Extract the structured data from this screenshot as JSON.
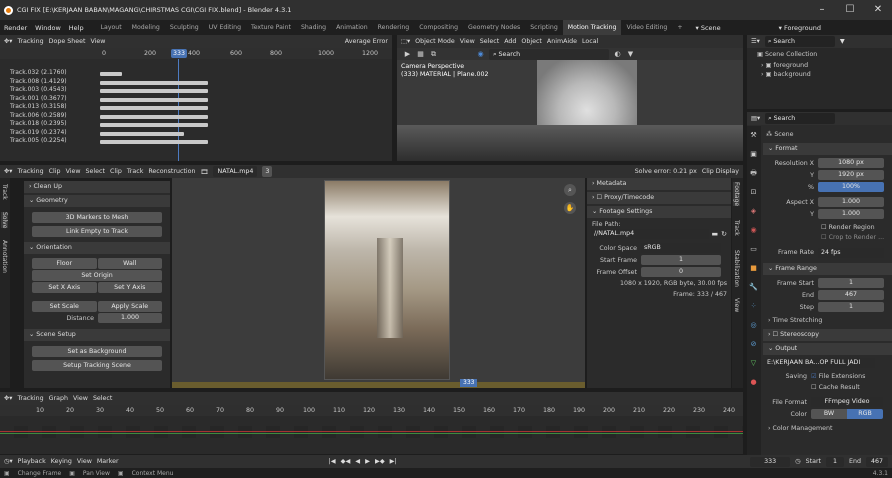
{
  "title": "CGI FIX [E:\\KERJAAN BABAN\\MAGANG\\CHIRSTMAS CGI\\CGI FIX.blend] - Blender 4.3.1",
  "menus": [
    "Render",
    "Window",
    "Help"
  ],
  "workspaces": [
    "Layout",
    "Modeling",
    "Sculpting",
    "UV Editing",
    "Texture Paint",
    "Shading",
    "Animation",
    "Rendering",
    "Compositing",
    "Geometry Nodes",
    "Scripting",
    "Motion Tracking",
    "Video Editing"
  ],
  "active_workspace": "Motion Tracking",
  "scene_label": "Scene",
  "view_layer": "Foreground",
  "dopesheet": {
    "mode": "Tracking",
    "sheet": "Dope Sheet",
    "view": "View",
    "sort": "Average Error",
    "ticks": [
      "0",
      "200",
      "400",
      "600",
      "800",
      "1000",
      "1200"
    ],
    "frame": "333",
    "tracks": [
      "Track.032 (2.1760)",
      "Track.008 (1.4129)",
      "Track.003 (0.4543)",
      "Track.001 (0.3677)",
      "Track.013 (0.3158)",
      "Track.006 (0.2589)",
      "Track.018 (0.2395)",
      "Track.019 (0.2374)",
      "Track.005 (0.2254)"
    ]
  },
  "viewport": {
    "mode": "Object Mode",
    "view": "View",
    "select": "Select",
    "add": "Add",
    "object": "Object",
    "animaide": "AnimAide",
    "orientation": "Local",
    "search": "Search",
    "overlay1": "Camera Perspective",
    "overlay2": "(333) MATERIAL | Plane.002"
  },
  "outliner": {
    "search": "Search",
    "root": "Scene Collection",
    "items": [
      "foreground",
      "background"
    ]
  },
  "clip": {
    "mode": "Tracking",
    "clip_menu": "Clip",
    "view": "View",
    "select": "Select",
    "clip": "Clip",
    "track": "Track",
    "reconstruction": "Reconstruction",
    "file": "NATAL.mp4",
    "users": "3",
    "solve": "Solve error: 0.21 px",
    "display": "Clip Display",
    "frame_badge": "333"
  },
  "tool_tabs": [
    "Track",
    "Solve",
    "Annotation"
  ],
  "tools": {
    "cleanup": "Clean Up",
    "geometry": "Geometry",
    "markers_to_mesh": "3D Markers to Mesh",
    "link_empty": "Link Empty to Track",
    "orientation": "Orientation",
    "floor": "Floor",
    "wall": "Wall",
    "set_origin": "Set Origin",
    "set_x": "Set X Axis",
    "set_y": "Set Y Axis",
    "set_scale": "Set Scale",
    "apply_scale": "Apply Scale",
    "distance_label": "Distance",
    "distance_value": "1.000",
    "scene_setup": "Scene Setup",
    "set_bg": "Set as Background",
    "setup_scene": "Setup Tracking Scene"
  },
  "footage": {
    "metadata": "Metadata",
    "proxy": "Proxy/Timecode",
    "settings": "Footage Settings",
    "file_path_label": "File Path:",
    "file_path": "//NATAL.mp4",
    "color_space_label": "Color Space",
    "color_space": "sRGB",
    "start_label": "Start Frame",
    "start": "1",
    "offset_label": "Frame Offset",
    "offset": "0",
    "info": "1080 x 1920, RGB byte, 30.00 fps",
    "frame_info": "Frame: 333 / 467"
  },
  "side_tabs": [
    "Footage",
    "Track",
    "Stabilization",
    "View"
  ],
  "props": {
    "search": "Search",
    "scene": "Scene",
    "format": "Format",
    "res_x_label": "Resolution X",
    "res_x": "1080 px",
    "res_y_label": "Y",
    "res_y": "1920 px",
    "pct_label": "%",
    "pct": "100%",
    "aspect_x_label": "Aspect X",
    "aspect_x": "1.000",
    "aspect_y_label": "Y",
    "aspect_y": "1.000",
    "render_region": "Render Region",
    "crop": "Crop to Render ...",
    "frame_rate_label": "Frame Rate",
    "frame_rate": "24 fps",
    "frame_range": "Frame Range",
    "fstart_label": "Frame Start",
    "fstart": "1",
    "fend_label": "End",
    "fend": "467",
    "step_label": "Step",
    "step": "1",
    "time_stretching": "Time Stretching",
    "stereoscopy": "Stereoscopy",
    "output": "Output",
    "output_path": "E:\\KERJAAN BA...OP FULL JADI",
    "saving_label": "Saving",
    "file_ext": "File Extensions",
    "cache": "Cache Result",
    "file_format_label": "File Format",
    "file_format": "FFmpeg Video",
    "color_label": "Color",
    "color_bw": "BW",
    "color_rgb": "RGB",
    "color_mgmt": "Color Management"
  },
  "graph": {
    "mode": "Tracking",
    "type": "Graph",
    "view": "View",
    "select": "Select",
    "ticks": [
      "10",
      "20",
      "30",
      "40",
      "50",
      "60",
      "70",
      "80",
      "90",
      "100",
      "110",
      "120",
      "130",
      "140",
      "150",
      "160",
      "170",
      "180",
      "190",
      "200",
      "210",
      "220",
      "230",
      "240"
    ]
  },
  "timeline": {
    "playback": "Playback",
    "keying": "Keying",
    "view": "View",
    "marker": "Marker",
    "frame": "333",
    "start_label": "Start",
    "start": "1",
    "end_label": "End",
    "end": "467"
  },
  "status": {
    "change_frame": "Change Frame",
    "pan_view": "Pan View",
    "context_menu": "Context Menu",
    "version": "4.3.1"
  },
  "colors": {
    "accent": "#4772b3",
    "playhead": "#4d7bc1",
    "bg": "#1d1d1d",
    "panel": "#303030",
    "field": "#545454"
  }
}
